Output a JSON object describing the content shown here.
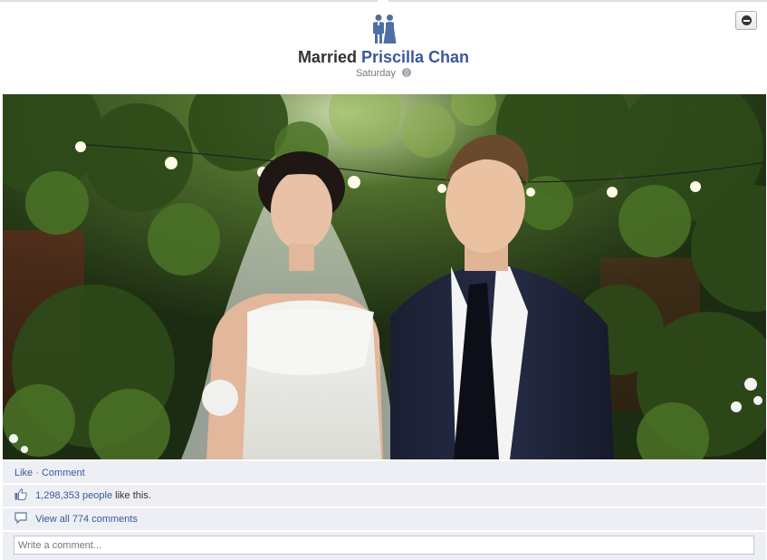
{
  "story": {
    "action": "Married",
    "name": "Priscilla Chan",
    "timestamp": "Saturday",
    "icon": "married-couple-icon",
    "privacy_icon": "globe-icon"
  },
  "actions": {
    "like": "Like",
    "separator": "·",
    "comment": "Comment"
  },
  "likes": {
    "count_text": "1,298,353 people",
    "suffix": " like this."
  },
  "comments": {
    "view_all": "View all 774 comments"
  },
  "comment_box": {
    "placeholder": "Write a comment..."
  },
  "colors": {
    "link": "#3b5998",
    "ufi_background": "#edeff4"
  }
}
